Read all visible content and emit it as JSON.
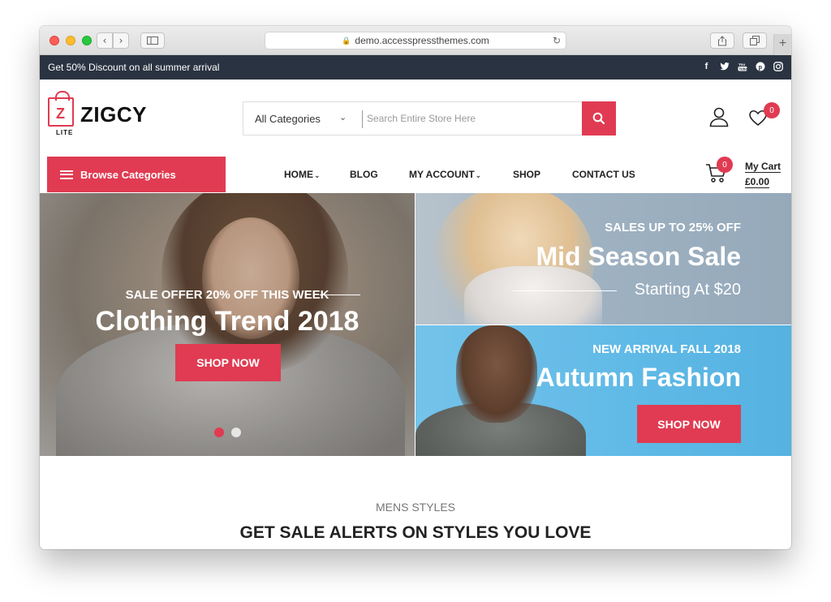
{
  "browser": {
    "url": "demo.accesspressthemes.com"
  },
  "topbar": {
    "promo": "Get 50% Discount on all summer arrival",
    "social_icons": [
      "facebook-icon",
      "twitter-icon",
      "youtube-icon",
      "pinterest-icon",
      "instagram-icon"
    ]
  },
  "header": {
    "logo_name": "ZIGCY",
    "logo_badge": "LITE",
    "search": {
      "category": "All Categories",
      "placeholder": "Search Entire Store Here"
    },
    "wishlist_count": "0"
  },
  "nav": {
    "browse_label": "Browse Categories",
    "items": [
      {
        "label": "HOME",
        "has_caret": true
      },
      {
        "label": "BLOG",
        "has_caret": false
      },
      {
        "label": "MY ACCOUNT",
        "has_caret": true
      },
      {
        "label": "SHOP",
        "has_caret": false
      },
      {
        "label": "CONTACT US",
        "has_caret": false
      }
    ],
    "cart": {
      "count": "0",
      "label": "My Cart",
      "total": "£0.00"
    }
  },
  "hero": {
    "main": {
      "subtitle": "SALE OFFER 20% OFF THIS WEEK",
      "title": "Clothing Trend 2018",
      "button": "SHOP NOW"
    },
    "banner_top": {
      "subtitle": "SALES UP TO 25% OFF",
      "title": "Mid Season Sale",
      "tagline": "Starting At $20"
    },
    "banner_bottom": {
      "subtitle": "NEW ARRIVAL FALL 2018",
      "title": "Autumn Fashion",
      "button": "SHOP NOW"
    }
  },
  "section": {
    "subtitle": "MENS STYLES",
    "title": "GET SALE ALERTS ON STYLES YOU LOVE"
  },
  "colors": {
    "accent": "#e03b52",
    "topbar": "#2a3341"
  }
}
